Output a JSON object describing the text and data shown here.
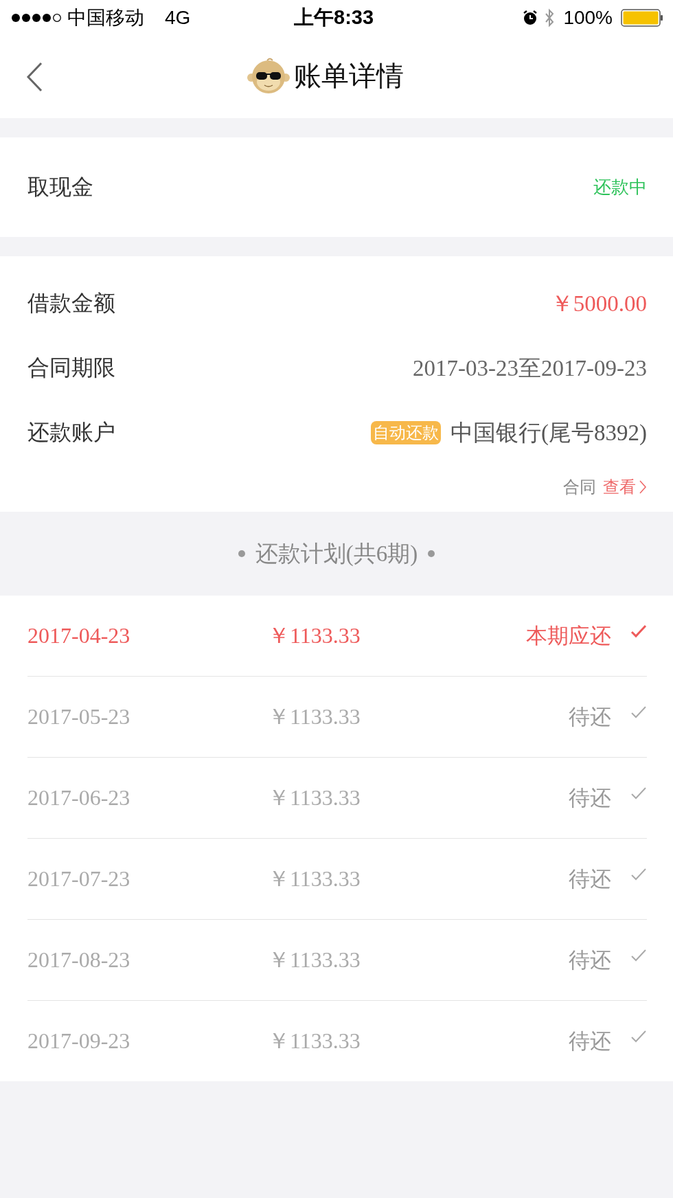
{
  "status_bar": {
    "carrier": "中国移动",
    "network": "4G",
    "time": "上午8:33",
    "battery": "100%"
  },
  "nav": {
    "title": "账单详情"
  },
  "loan_type": {
    "label": "取现金",
    "status": "还款中"
  },
  "details": [
    {
      "label": "借款金额",
      "value": "￥5000.00",
      "kind": "amount"
    },
    {
      "label": "合同期限",
      "value": "2017-03-23至2017-09-23",
      "kind": "plain"
    },
    {
      "label": "还款账户",
      "badge": "自动还款",
      "value": "中国银行(尾号8392)",
      "kind": "account"
    }
  ],
  "contract": {
    "label": "合同",
    "link": "查看"
  },
  "schedule": {
    "title": "还款计划(共6期)",
    "rows": [
      {
        "date": "2017-04-23",
        "amount": "￥1133.33",
        "status": "本期应还",
        "current": true
      },
      {
        "date": "2017-05-23",
        "amount": "￥1133.33",
        "status": "待还",
        "current": false
      },
      {
        "date": "2017-06-23",
        "amount": "￥1133.33",
        "status": "待还",
        "current": false
      },
      {
        "date": "2017-07-23",
        "amount": "￥1133.33",
        "status": "待还",
        "current": false
      },
      {
        "date": "2017-08-23",
        "amount": "￥1133.33",
        "status": "待还",
        "current": false
      },
      {
        "date": "2017-09-23",
        "amount": "￥1133.33",
        "status": "待还",
        "current": false
      }
    ]
  }
}
